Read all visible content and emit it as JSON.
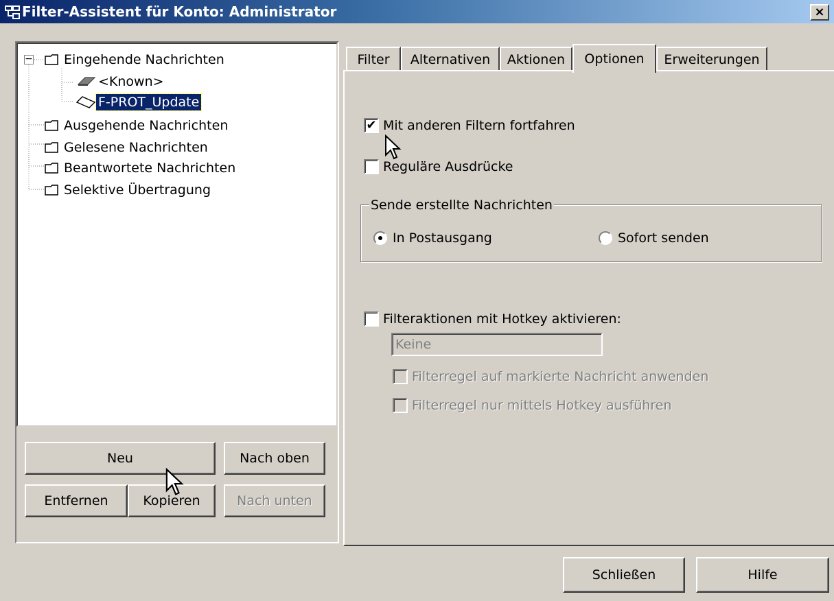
{
  "window": {
    "title": "Filter-Assistent für Konto: Administrator",
    "close_glyph": "×",
    "title_icon": "filter-wizard-icon"
  },
  "tree": {
    "items": [
      {
        "label": "Eingehende Nachrichten",
        "icon": "folder-icon",
        "expanded": true
      },
      {
        "label": "<Known>",
        "icon": "filter-rule-icon"
      },
      {
        "label": "F-PROT_Update",
        "icon": "filter-rule-icon",
        "selected": true
      },
      {
        "label": "Ausgehende Nachrichten",
        "icon": "folder-icon"
      },
      {
        "label": "Gelesene Nachrichten",
        "icon": "folder-icon"
      },
      {
        "label": "Beantwortete Nachrichten",
        "icon": "folder-icon"
      },
      {
        "label": "Selektive Übertragung",
        "icon": "folder-icon"
      }
    ],
    "expander_glyph": "−"
  },
  "left_buttons": {
    "new": "Neu",
    "up": "Nach oben",
    "remove": "Entfernen",
    "copy": "Kopieren",
    "down": "Nach unten"
  },
  "tabs": [
    {
      "label": "Filter"
    },
    {
      "label": "Alternativen"
    },
    {
      "label": "Aktionen"
    },
    {
      "label": "Optionen",
      "active": true
    },
    {
      "label": "Erweiterungen"
    }
  ],
  "options": {
    "continue_filters": {
      "label": "Mit anderen Filtern fortfahren",
      "checked": true
    },
    "regex": {
      "label": "Reguläre Ausdrücke",
      "checked": false
    },
    "send_group": {
      "title": "Sende erstellte Nachrichten",
      "outbox": {
        "label": "In Postausgang",
        "selected": true
      },
      "send_now": {
        "label": "Sofort senden",
        "selected": false
      }
    },
    "hotkey": {
      "label": "Filteraktionen mit Hotkey aktivieren:",
      "checked": false
    },
    "hotkey_value": "Keine",
    "apply_marked": {
      "label": "Filterregel auf markierte Nachricht anwenden",
      "checked": false,
      "disabled": true
    },
    "hotkey_only": {
      "label": "Filterregel nur mittels Hotkey ausführen",
      "checked": false,
      "disabled": true
    }
  },
  "bottom_buttons": {
    "close": "Schließen",
    "help": "Hilfe"
  },
  "check_glyph": "✔"
}
